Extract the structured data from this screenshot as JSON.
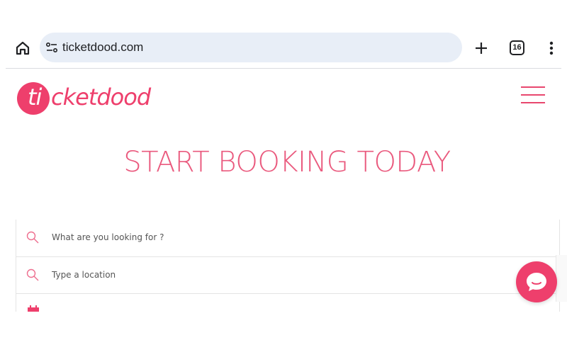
{
  "browser": {
    "url": "ticketdood.com",
    "tab_count": "16",
    "icons": {
      "home": "home-icon",
      "site_settings": "tune-icon",
      "new_tab": "plus-icon",
      "tabs": "tab-switcher-icon",
      "menu": "more-vert-icon"
    }
  },
  "site": {
    "logo_ti": "ti",
    "logo_rest": "cketdood",
    "brand_color": "#ee3f6c",
    "menu_icon": "hamburger-icon"
  },
  "hero": {
    "title": "START BOOKING TODAY"
  },
  "search": {
    "what_placeholder": "What are you looking for ?",
    "location_placeholder": "Type a location",
    "icons": {
      "what": "search-icon",
      "location": "search-icon",
      "date": "calendar-icon"
    }
  },
  "chat": {
    "icon": "chat-bubble-icon"
  }
}
